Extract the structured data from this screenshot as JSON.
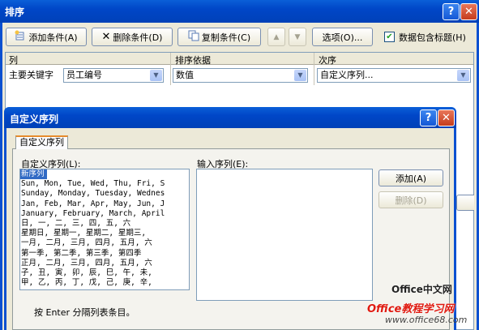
{
  "sort_dialog": {
    "title": "排序",
    "help_label": "?",
    "close_label": "✕",
    "toolbar": {
      "add_label": "添加条件(A)",
      "delete_label": "删除条件(D)",
      "copy_label": "复制条件(C)",
      "up_label": "▲",
      "down_label": "▼",
      "options_label": "选项(O)...",
      "header_checkbox_label": "数据包含标题(H)",
      "header_checked": true
    },
    "columns": {
      "col": "列",
      "sort_on": "排序依据",
      "order": "次序"
    },
    "row": {
      "label": "主要关键字",
      "column_value": "员工编号",
      "sort_on_value": "数值",
      "order_value": "自定义序列..."
    }
  },
  "custom_lists_dialog": {
    "title": "自定义序列",
    "help_label": "?",
    "close_label": "✕",
    "tab_label": "自定义序列",
    "lists_label": "自定义序列(L):",
    "entries_label": "输入序列(E):",
    "lists": [
      "新序列",
      "Sun, Mon, Tue, Wed, Thu, Fri, S",
      "Sunday, Monday, Tuesday, Wednes",
      "Jan, Feb, Mar, Apr, May, Jun, J",
      "January, February, March, April",
      "日, 一, 二, 三, 四, 五, 六",
      "星期日, 星期一, 星期二, 星期三,",
      "一月, 二月, 三月, 四月, 五月, 六",
      "第一季, 第二季, 第三季, 第四季",
      "正月, 二月, 三月, 四月, 五月, 六",
      "子, 丑, 寅, 卯, 辰, 巳, 午, 未,",
      "甲, 乙, 丙, 丁, 戊, 己, 庚, 辛,"
    ],
    "selected_index": 0,
    "add_label": "添加(A)",
    "delete_label": "删除(D)",
    "hint": "按 Enter 分隔列表条目。"
  },
  "watermark": {
    "line1": "Office中文网",
    "line2": "Office教程学习网",
    "line3": "www.office68.com"
  }
}
